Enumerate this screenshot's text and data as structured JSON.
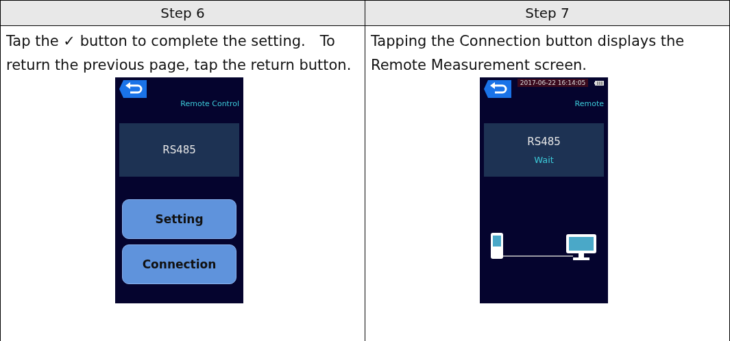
{
  "steps": [
    {
      "title": "Step 6",
      "text": "Tap the ✓ button to complete the setting.　To return the previous page, tap the return button.",
      "device": {
        "kind": "menu",
        "title": "Remote Control",
        "port": "RS485",
        "buttons": [
          "Setting",
          "Connection"
        ]
      }
    },
    {
      "title": "Step 7",
      "text": "Tapping the Connection button displays the Remote Measurement screen.",
      "device": {
        "kind": "status",
        "datetime": "2017-06-22 16:14:05",
        "title": "Remote",
        "port": "RS485",
        "status": "Wait"
      }
    }
  ]
}
